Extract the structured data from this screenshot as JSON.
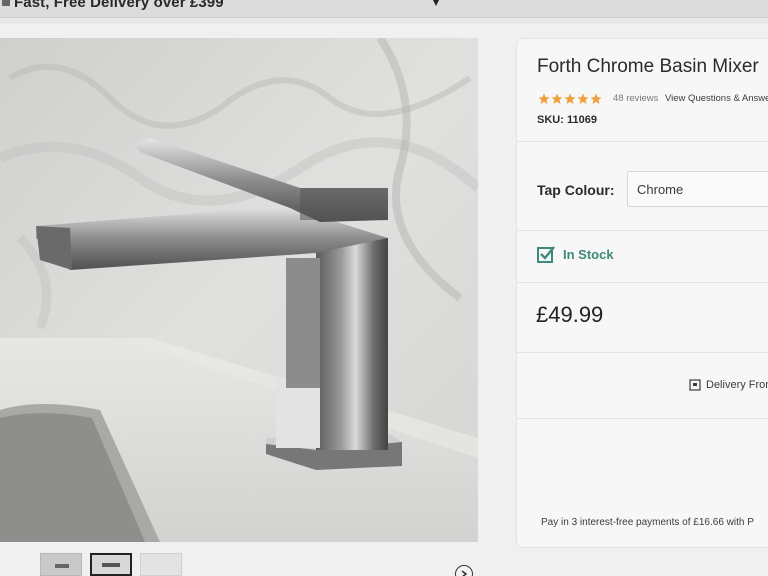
{
  "promo": {
    "text": "Fast, Free Delivery over £399"
  },
  "icons": {
    "truck": "truck-icon",
    "wishlist": "heart-icon",
    "stock": "checkbox-icon",
    "delivery": "delivery-icon",
    "next": "chevron-right-icon"
  },
  "product": {
    "title": "Forth Chrome Basin Mixer",
    "rating_stars": 5,
    "reviews": "48 reviews",
    "questions_link": "View Questions & Answers",
    "sku_label": "SKU:",
    "sku_value": "11069",
    "tap_colour_label": "Tap Colour:",
    "tap_colour_value": "Chrome",
    "stock_status": "In Stock",
    "price": "£49.99",
    "delivery_text": "Delivery From",
    "pay_text": "Pay in 3 interest-free payments of £16.66 with P"
  },
  "colors": {
    "star": "#f0a03a",
    "stock": "#3c8a7a",
    "text": "#2b2b2b"
  }
}
